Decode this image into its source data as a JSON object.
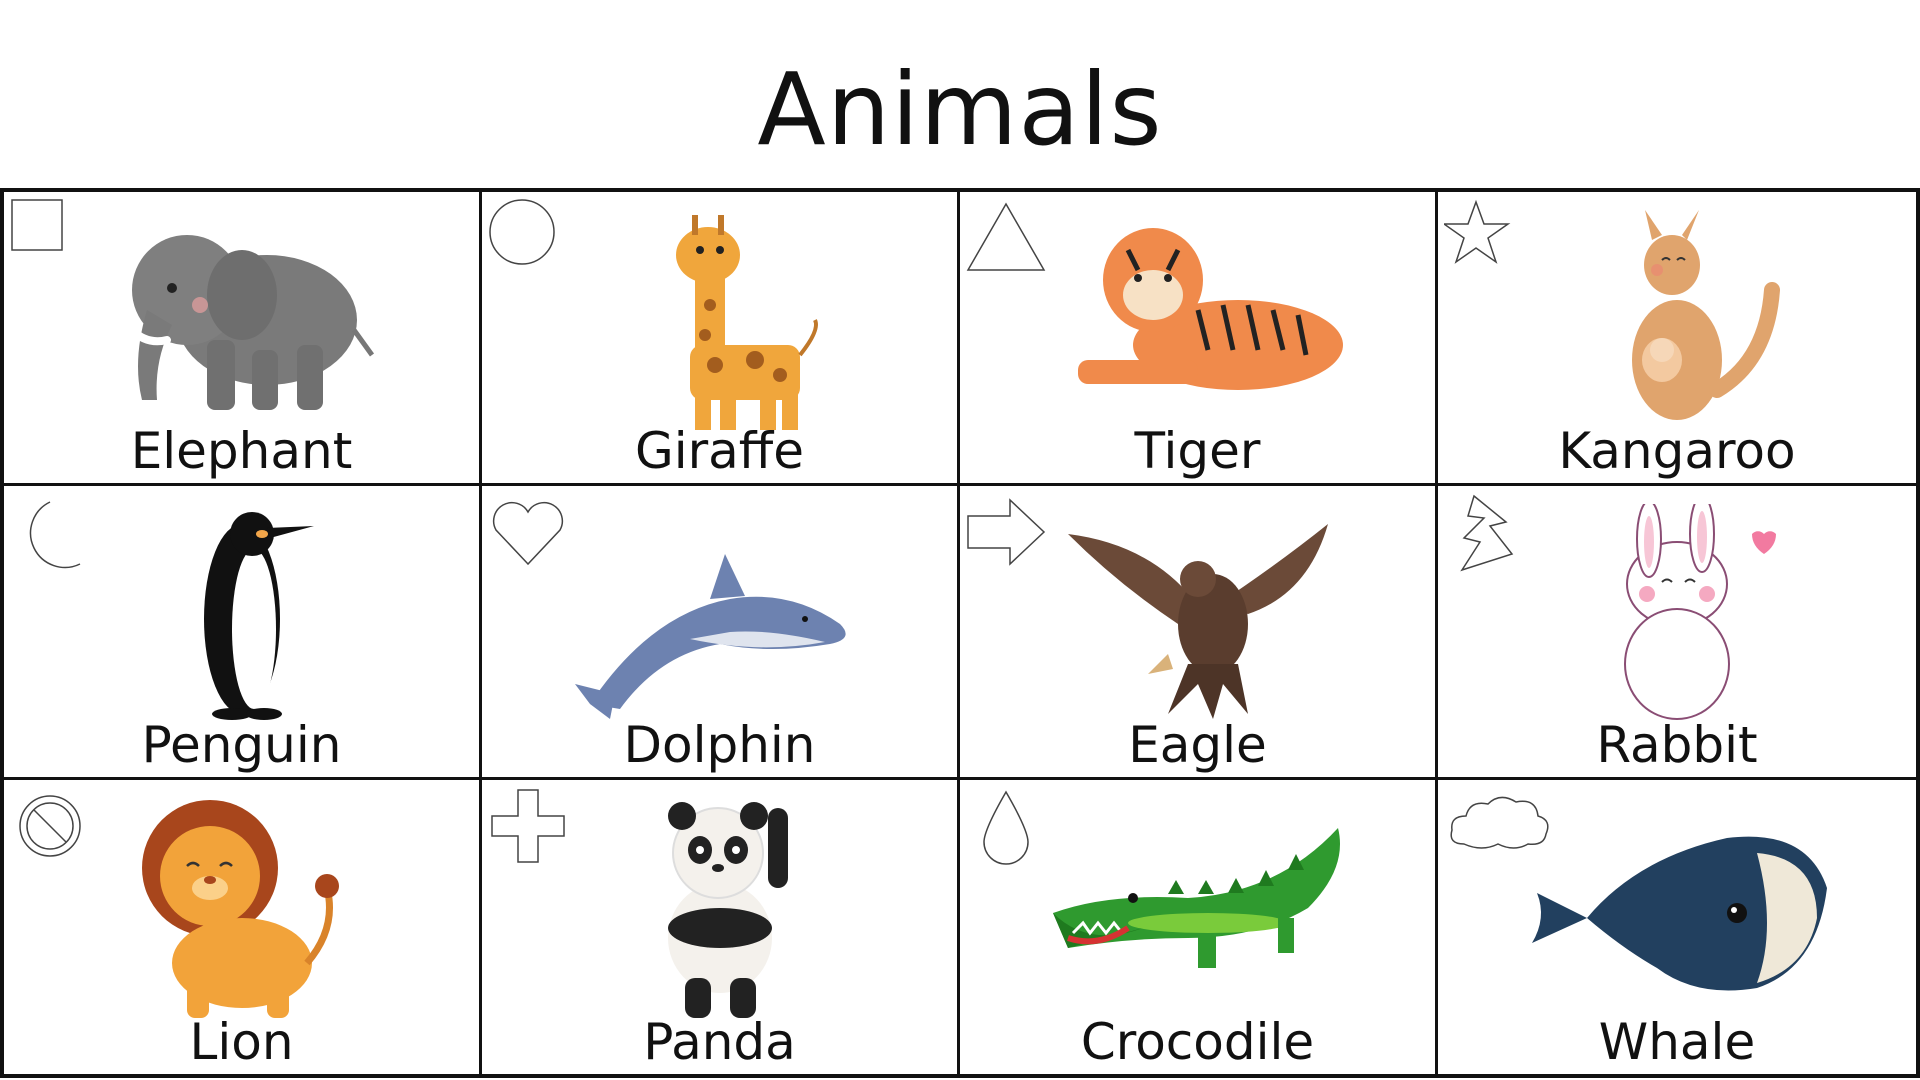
{
  "title": "Animals",
  "cards": [
    {
      "label": "Elephant",
      "shape": "square-icon",
      "animal": "elephant-image"
    },
    {
      "label": "Giraffe",
      "shape": "circle-icon",
      "animal": "giraffe-image"
    },
    {
      "label": "Tiger",
      "shape": "triangle-icon",
      "animal": "tiger-image"
    },
    {
      "label": "Kangaroo",
      "shape": "star-icon",
      "animal": "kangaroo-image"
    },
    {
      "label": "Penguin",
      "shape": "crescent-moon-icon",
      "animal": "penguin-image"
    },
    {
      "label": "Dolphin",
      "shape": "heart-icon",
      "animal": "dolphin-image"
    },
    {
      "label": "Eagle",
      "shape": "arrow-right-icon",
      "animal": "eagle-image"
    },
    {
      "label": "Rabbit",
      "shape": "lightning-bolt-icon",
      "animal": "rabbit-image"
    },
    {
      "label": "Lion",
      "shape": "prohibited-icon",
      "animal": "lion-image"
    },
    {
      "label": "Panda",
      "shape": "plus-icon",
      "animal": "panda-image"
    },
    {
      "label": "Crocodile",
      "shape": "droplet-icon",
      "animal": "crocodile-image"
    },
    {
      "label": "Whale",
      "shape": "cloud-icon",
      "animal": "whale-image"
    }
  ],
  "colors": {
    "elephant": "#7a7a7a",
    "giraffe": "#f0a63c",
    "tiger": "#f08a4b",
    "kangaroo": "#e0a46d",
    "penguin": "#111111",
    "dolphin": "#6d82b0",
    "eagle": "#6b4a38",
    "rabbit": "#ffffff",
    "lion": "#f2a33a",
    "panda": "#222222",
    "crocodile": "#2f9a2f",
    "whale": "#22405f"
  }
}
